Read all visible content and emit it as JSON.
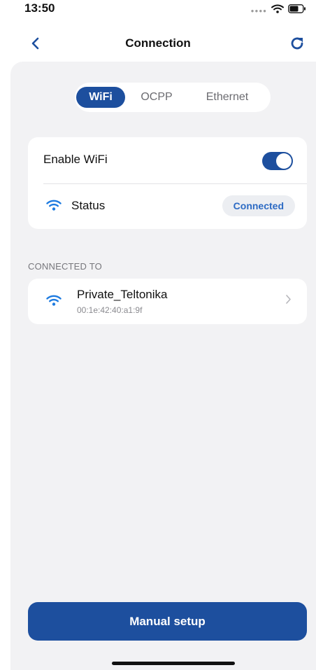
{
  "status_bar": {
    "time": "13:50",
    "icons": [
      "signal-dots-icon",
      "wifi-icon",
      "battery-icon"
    ]
  },
  "nav": {
    "title": "Connection",
    "back_icon": "chevron-left-icon",
    "refresh_icon": "refresh-icon"
  },
  "tabs": [
    {
      "label": "WiFi",
      "active": true
    },
    {
      "label": "OCPP",
      "active": false
    },
    {
      "label": "Ethernet",
      "active": false
    }
  ],
  "wifi_card": {
    "enable_label": "Enable WiFi",
    "enabled": true,
    "status_label": "Status",
    "status_value": "Connected"
  },
  "connected_section": {
    "header": "CONNECTED TO",
    "network": {
      "name": "Private_Teltonika",
      "mac": "00:1e:42:40:a1:9f"
    }
  },
  "footer": {
    "manual_setup_label": "Manual setup"
  },
  "colors": {
    "accent": "#1d4f9e",
    "wifi_icon": "#1e7be0",
    "badge_text": "#2d6bc4",
    "background": "#f2f2f4"
  }
}
